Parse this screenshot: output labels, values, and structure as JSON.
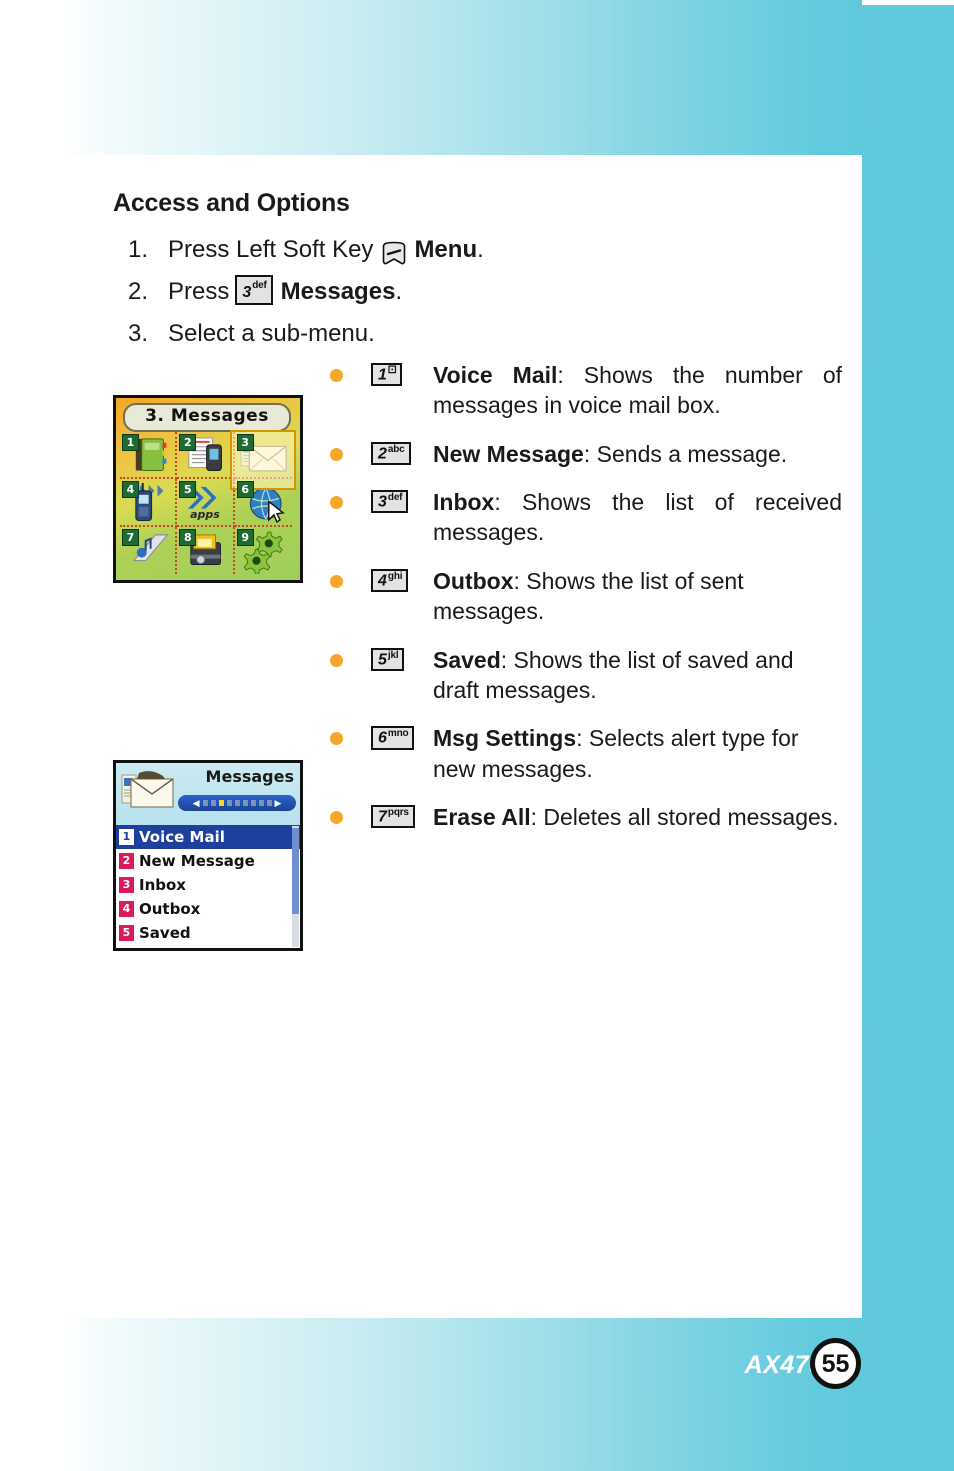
{
  "document": {
    "section_title": "Access and Options",
    "footer": {
      "model": "AX4750",
      "page_number": "55"
    },
    "colors": {
      "background_cyan": "#5CC9DC",
      "bullet_orange": "#F4A72A",
      "key_fill": "#E3E3E3",
      "list_select_blue": "#1D3F9E",
      "list_badge_pink": "#D81B60",
      "grid_badge_green": "#1E6B33"
    }
  },
  "steps": [
    {
      "number": "1.",
      "pre": "Press Left Soft Key",
      "icon": "soft-key-icon",
      "bold": "Menu",
      "post": "."
    },
    {
      "number": "2.",
      "pre": "Press",
      "key": {
        "num": "3",
        "sub": "def"
      },
      "bold": "Messages",
      "post": "."
    },
    {
      "number": "3.",
      "pre": "Select a sub-menu.",
      "bold": "",
      "post": ""
    }
  ],
  "bullets": [
    {
      "key": {
        "num": "1",
        "sub": "⚀"
      },
      "title": "Voice Mail",
      "desc": ": Shows the number of messages in voice mail box.",
      "justify": true
    },
    {
      "key": {
        "num": "2",
        "sub": "abc"
      },
      "title": "New Message",
      "desc": ": Sends a message.",
      "justify": false
    },
    {
      "key": {
        "num": "3",
        "sub": "def"
      },
      "title": "Inbox",
      "desc": ": Shows the list of received messages.",
      "justify": true
    },
    {
      "key": {
        "num": "4",
        "sub": "ghi"
      },
      "title": "Outbox",
      "desc": ": Shows the list of sent messages.",
      "justify": false
    },
    {
      "key": {
        "num": "5",
        "sub": "jkl"
      },
      "title": "Saved",
      "desc": ": Shows the list of saved and draft messages.",
      "justify": false
    },
    {
      "key": {
        "num": "6",
        "sub": "mno"
      },
      "title": "Msg Settings",
      "desc": ": Selects alert type for new messages.",
      "justify": false
    },
    {
      "key": {
        "num": "7",
        "sub": "pqrs"
      },
      "title": "Erase All",
      "desc": ": Deletes all stored messages.",
      "justify": false
    }
  ],
  "phone_menu_grid": {
    "title": "3. Messages",
    "apps_label": "apps",
    "selected_index": 3,
    "cells": [
      {
        "num": "1",
        "icon": "address-book-icon"
      },
      {
        "num": "2",
        "icon": "phone-papers-icon"
      },
      {
        "num": "3",
        "icon": "envelope-icon"
      },
      {
        "num": "4",
        "icon": "handset-signal-icon"
      },
      {
        "num": "5",
        "icon": "chevrons-apps-icon"
      },
      {
        "num": "6",
        "icon": "globe-cursor-icon"
      },
      {
        "num": "7",
        "icon": "music-note-icon"
      },
      {
        "num": "8",
        "icon": "toolbox-icon"
      },
      {
        "num": "9",
        "icon": "gears-settings-icon"
      }
    ]
  },
  "phone_messages_list": {
    "header_title": "Messages",
    "header_icon": "envelope-icon",
    "nav_dots_total": 9,
    "nav_dot_active": 3,
    "items": [
      {
        "num": "1",
        "label": "Voice Mail",
        "selected": true
      },
      {
        "num": "2",
        "label": "New Message",
        "selected": false
      },
      {
        "num": "3",
        "label": "Inbox",
        "selected": false
      },
      {
        "num": "4",
        "label": "Outbox",
        "selected": false
      },
      {
        "num": "5",
        "label": "Saved",
        "selected": false
      }
    ]
  }
}
